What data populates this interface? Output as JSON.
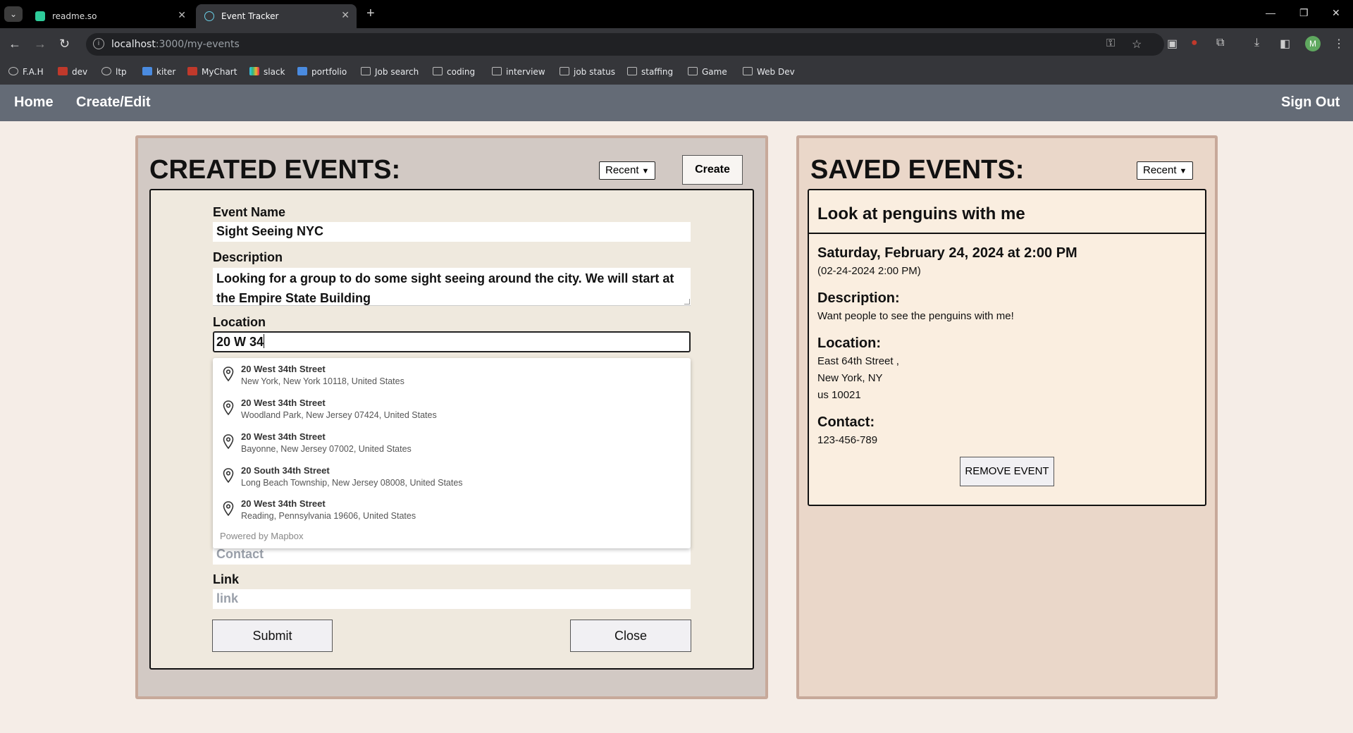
{
  "browser": {
    "tabs": [
      {
        "title": "readme.so",
        "active": false
      },
      {
        "title": "Event Tracker",
        "active": true
      }
    ],
    "url_host": "localhost",
    "url_path": ":3000/my-events",
    "bookmarks": [
      {
        "label": "F.A.H",
        "icon": "globe"
      },
      {
        "label": "dev",
        "icon": "red"
      },
      {
        "label": "ltp",
        "icon": "globe"
      },
      {
        "label": "kiter",
        "icon": "blue"
      },
      {
        "label": "MyChart",
        "icon": "red"
      },
      {
        "label": "slack",
        "icon": "multi"
      },
      {
        "label": "portfolio",
        "icon": "blue"
      },
      {
        "label": "Job search",
        "icon": "folder"
      },
      {
        "label": "coding",
        "icon": "folder"
      },
      {
        "label": "interview",
        "icon": "folder"
      },
      {
        "label": "job status",
        "icon": "folder"
      },
      {
        "label": "staffing",
        "icon": "folder"
      },
      {
        "label": "Game",
        "icon": "folder"
      },
      {
        "label": "Web Dev",
        "icon": "folder"
      }
    ],
    "profile_initial": "M"
  },
  "nav": {
    "home": "Home",
    "create_edit": "Create/Edit",
    "sign_out": "Sign Out"
  },
  "created": {
    "title": "CREATED EVENTS:",
    "sort": "Recent",
    "create_label": "Create",
    "form": {
      "event_name_label": "Event Name",
      "event_name_value": "Sight Seeing NYC",
      "description_label": "Description",
      "description_value": "Looking for a group to do some sight seeing around the city. We will start at the Empire State Building",
      "location_label": "Location",
      "location_value": "20 W 34",
      "contact_placeholder": "Contact",
      "link_label": "Link",
      "link_placeholder": "link",
      "submit_label": "Submit",
      "close_label": "Close"
    },
    "suggestions": [
      {
        "title": "20 West 34th Street",
        "sub": "New York, New York 10118, United States"
      },
      {
        "title": "20 West 34th Street",
        "sub": "Woodland Park, New Jersey 07424, United States"
      },
      {
        "title": "20 West 34th Street",
        "sub": "Bayonne, New Jersey 07002, United States"
      },
      {
        "title": "20 South 34th Street",
        "sub": "Long Beach Township, New Jersey 08008, United States"
      },
      {
        "title": "20 West 34th Street",
        "sub": "Reading, Pennsylvania 19606, United States"
      }
    ],
    "powered_by": "Powered by Mapbox"
  },
  "saved": {
    "title": "SAVED EVENTS:",
    "sort": "Recent",
    "event": {
      "title": "Look at penguins with me",
      "date": "Saturday, February 24, 2024 at 2:00 PM",
      "date_short": "(02-24-2024 2:00 PM)",
      "description_label": "Description:",
      "description": "Want people to see the penguins with me!",
      "location_label": "Location:",
      "location_line1": "East 64th Street ,",
      "location_line2": "New York, NY",
      "location_line3": "us 10021",
      "contact_label": "Contact:",
      "contact": "123-456-789",
      "remove_label": "REMOVE EVENT"
    }
  },
  "colors": {
    "navbar": "#646b76",
    "page_bg": "#f5ede7",
    "panel_border": "#c7a99a"
  }
}
